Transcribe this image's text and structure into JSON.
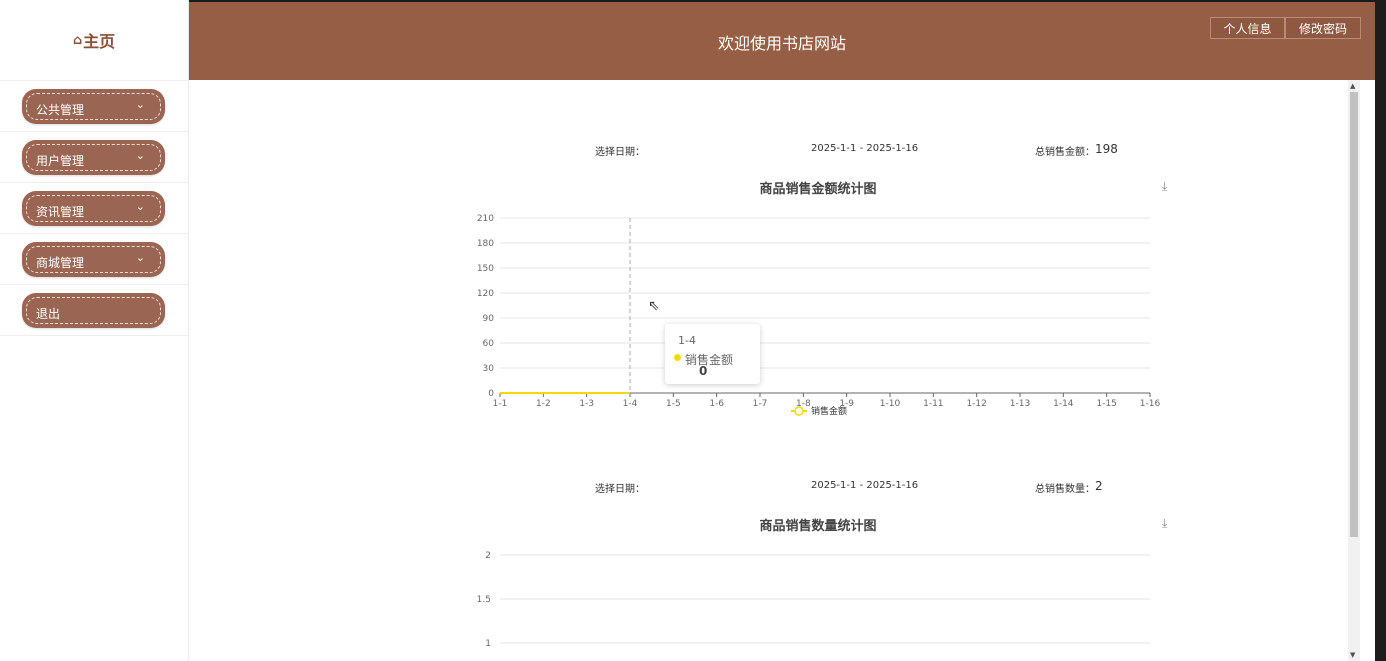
{
  "sidebar": {
    "home_label": "主页",
    "menu": [
      {
        "label": "公共管理",
        "has_chevron": true
      },
      {
        "label": "用户管理",
        "has_chevron": true
      },
      {
        "label": "资讯管理",
        "has_chevron": true
      },
      {
        "label": "商城管理",
        "has_chevron": true
      },
      {
        "label": "退出",
        "has_chevron": false
      }
    ]
  },
  "header": {
    "title": "欢迎使用书店网站",
    "profile_button": "个人信息",
    "password_button": "修改密码"
  },
  "colors": {
    "brand": "#965e45",
    "menu": "#9a6653",
    "series": "#f5d90a"
  },
  "sales_amount_section": {
    "date_label": "选择日期：",
    "date_range": "2025-1-1 - 2025-1-16",
    "total_label": "总销售金额：",
    "total_value": "198"
  },
  "sales_count_section": {
    "date_label": "选择日期：",
    "date_range": "2025-1-1 - 2025-1-16",
    "total_label": "总销售数量：",
    "total_value": "2"
  },
  "tooltip": {
    "category": "1-4",
    "series": "销售金额",
    "value": "0"
  },
  "chart_data": [
    {
      "type": "line",
      "title": "商品销售金额统计图",
      "categories": [
        "1-1",
        "1-2",
        "1-3",
        "1-4",
        "1-5",
        "1-6",
        "1-7",
        "1-8",
        "1-9",
        "1-10",
        "1-11",
        "1-12",
        "1-13",
        "1-14",
        "1-15",
        "1-16"
      ],
      "series": [
        {
          "name": "销售金额",
          "values": [
            0,
            0,
            0,
            0,
            null,
            null,
            null,
            null,
            null,
            null,
            null,
            null,
            null,
            null,
            null,
            null
          ]
        }
      ],
      "yticks": [
        0,
        30,
        60,
        90,
        120,
        150,
        180,
        210
      ],
      "ylim": [
        0,
        210
      ],
      "grid": true,
      "legend": "bottom-center"
    },
    {
      "type": "line",
      "title": "商品销售数量统计图",
      "categories": [],
      "series": [],
      "yticks": [
        1,
        1.5,
        2
      ],
      "ylim": [
        0,
        2
      ],
      "grid": true
    }
  ]
}
